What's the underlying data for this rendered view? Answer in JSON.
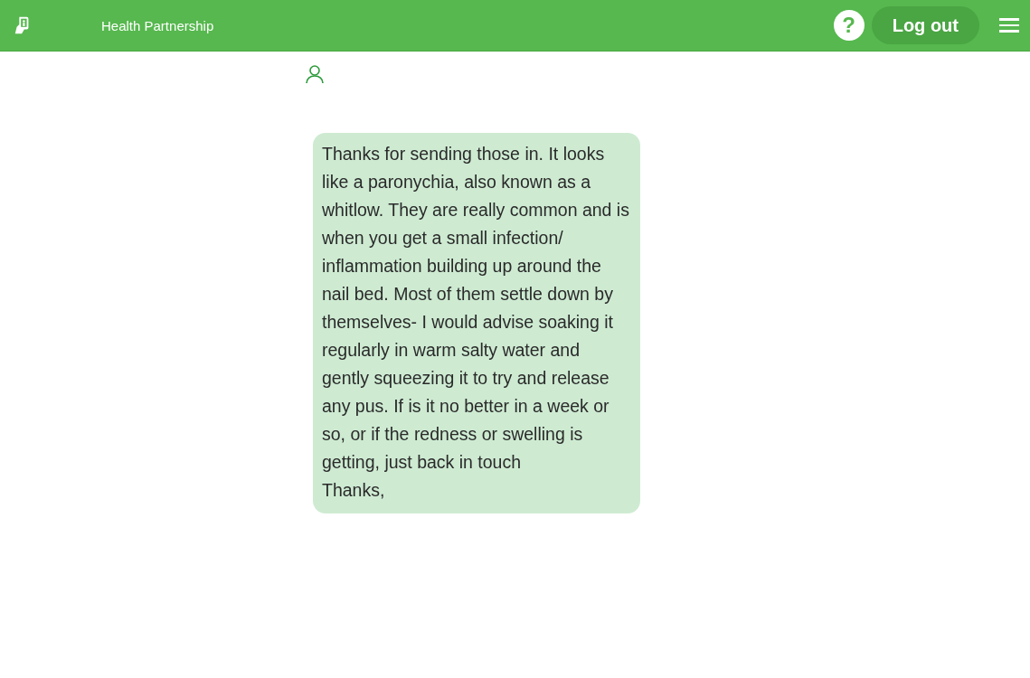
{
  "header": {
    "title": "Health Partnership",
    "help": "?",
    "logout": "Log out"
  },
  "message": {
    "paragraphs": [
      "Thanks for sending those in. It looks like a paronychia, also known as a whitlow. They are really common and is when you get a small infection/ inflammation building up around the nail bed. Most of them settle down by themselves- I would advise soaking it regularly in warm salty water and gently squeezing it to try and release any pus. If is it no better in a week or so, or if the redness or swelling is getting, just back in touch",
      "Thanks,"
    ]
  }
}
